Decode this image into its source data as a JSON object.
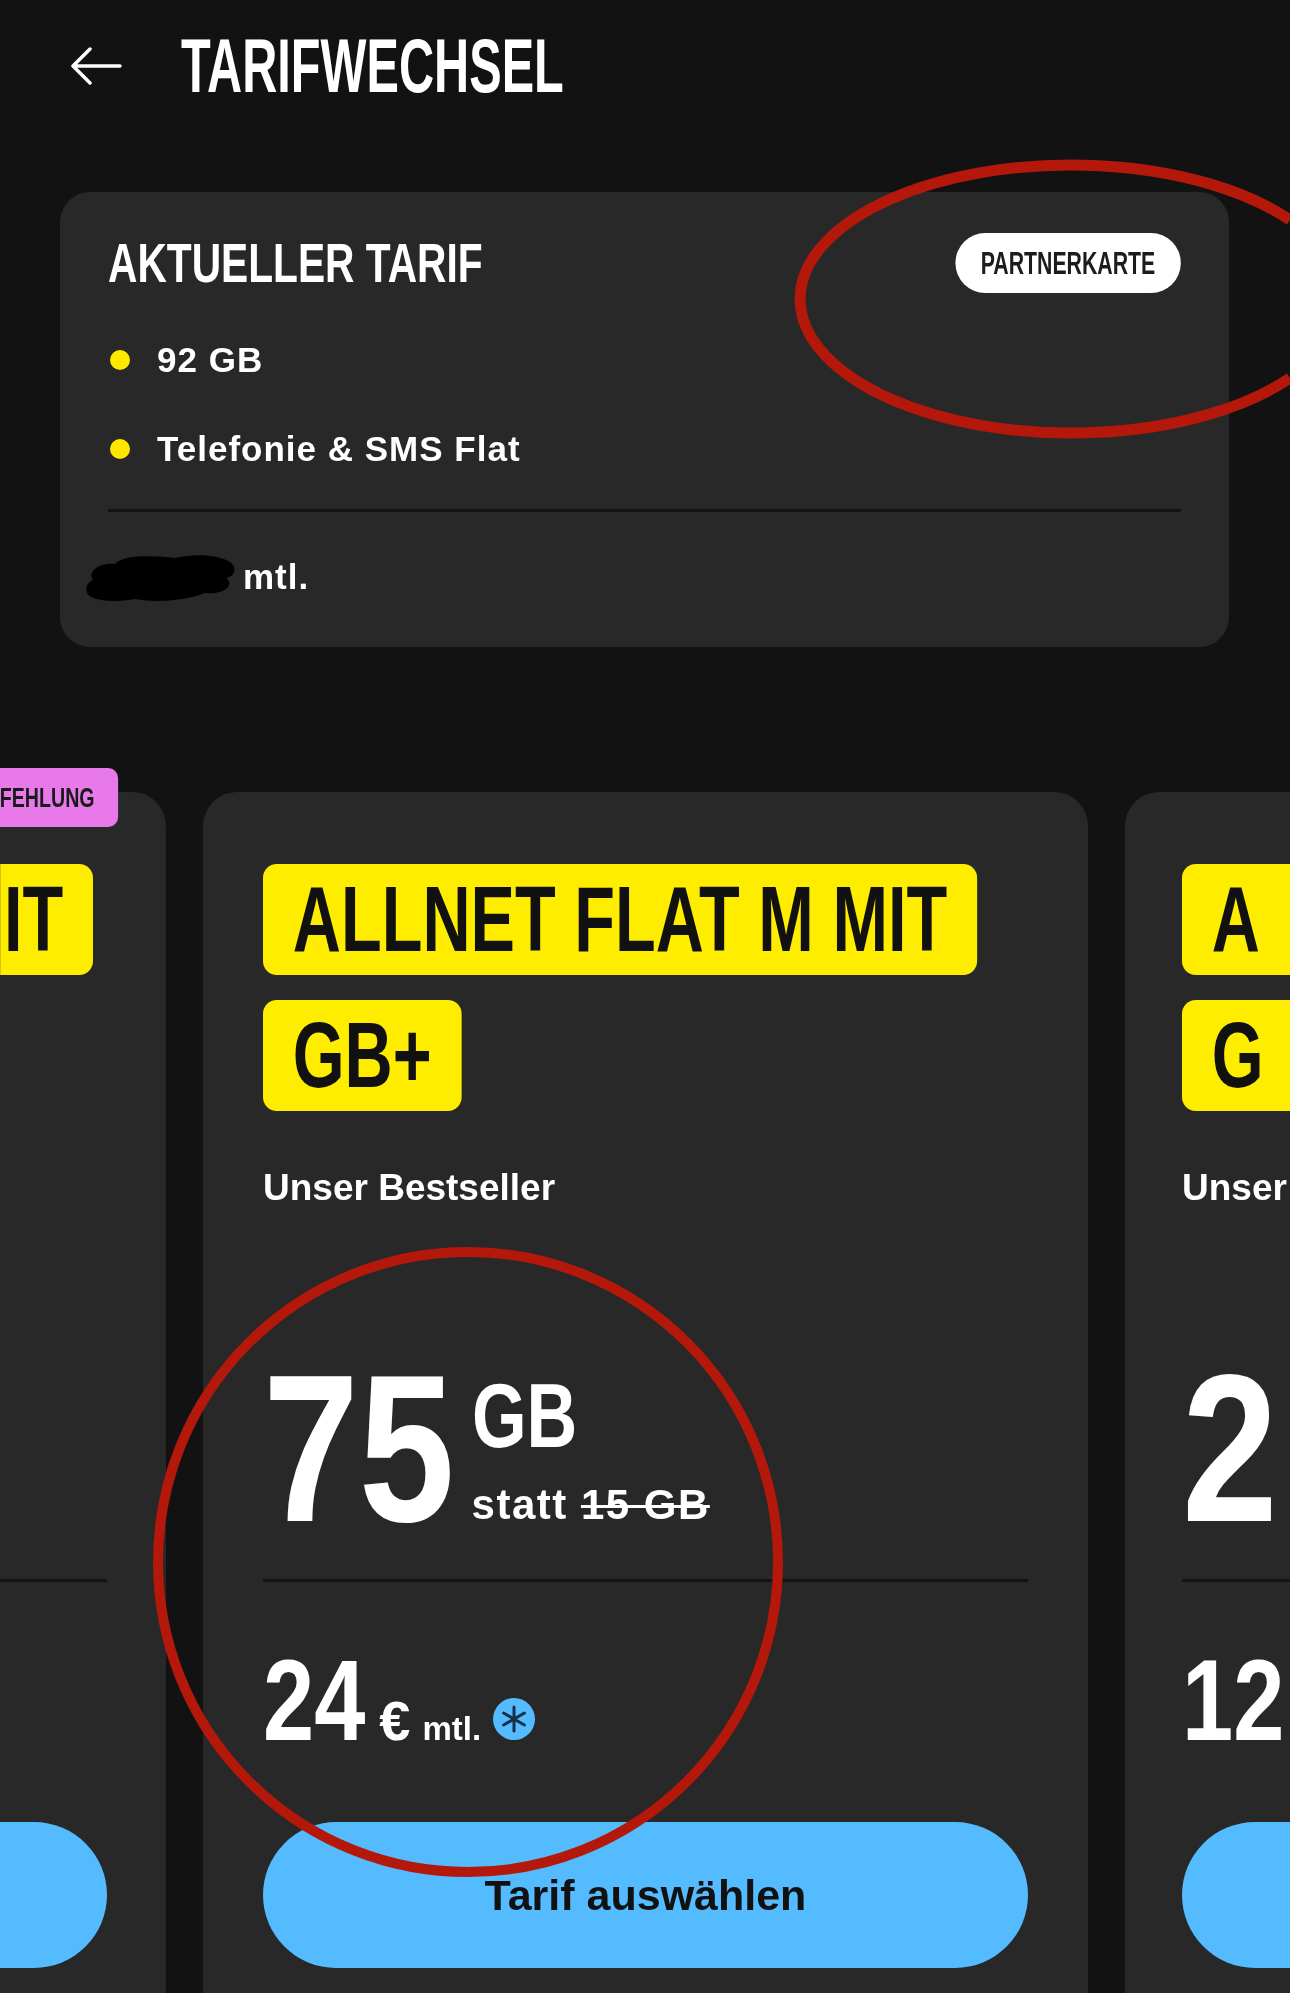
{
  "header": {
    "title": "TARIFWECHSEL"
  },
  "current_tariff": {
    "title": "AKTUELLER TARIF",
    "badge": {
      "label": "PARTNERKARTE",
      "circled": true
    },
    "features": [
      "92 GB",
      "Telefonie & SMS Flat"
    ],
    "price": {
      "redacted": true,
      "period": "mtl."
    }
  },
  "plans": [
    {
      "kind": "cut_left",
      "badge": "FEHLUNG",
      "title_lines": [
        "IT"
      ]
    },
    {
      "kind": "full",
      "title_lines": [
        "ALLNET FLAT M MIT",
        "GB+"
      ],
      "subtitle": "Unser Bestseller",
      "data": {
        "amount": "75",
        "unit": "GB",
        "note": "statt",
        "previous": "15 GB"
      },
      "price": {
        "amount": "24",
        "currency": "€",
        "period": "mtl.",
        "footnote_icon": true
      },
      "button": "Tarif auswählen",
      "circled": true
    },
    {
      "kind": "cut_right",
      "title_lines": [
        "A",
        "G"
      ],
      "subtitle": "Unser",
      "data": {
        "amount": "2"
      },
      "price": {
        "amount": "12"
      }
    }
  ]
}
